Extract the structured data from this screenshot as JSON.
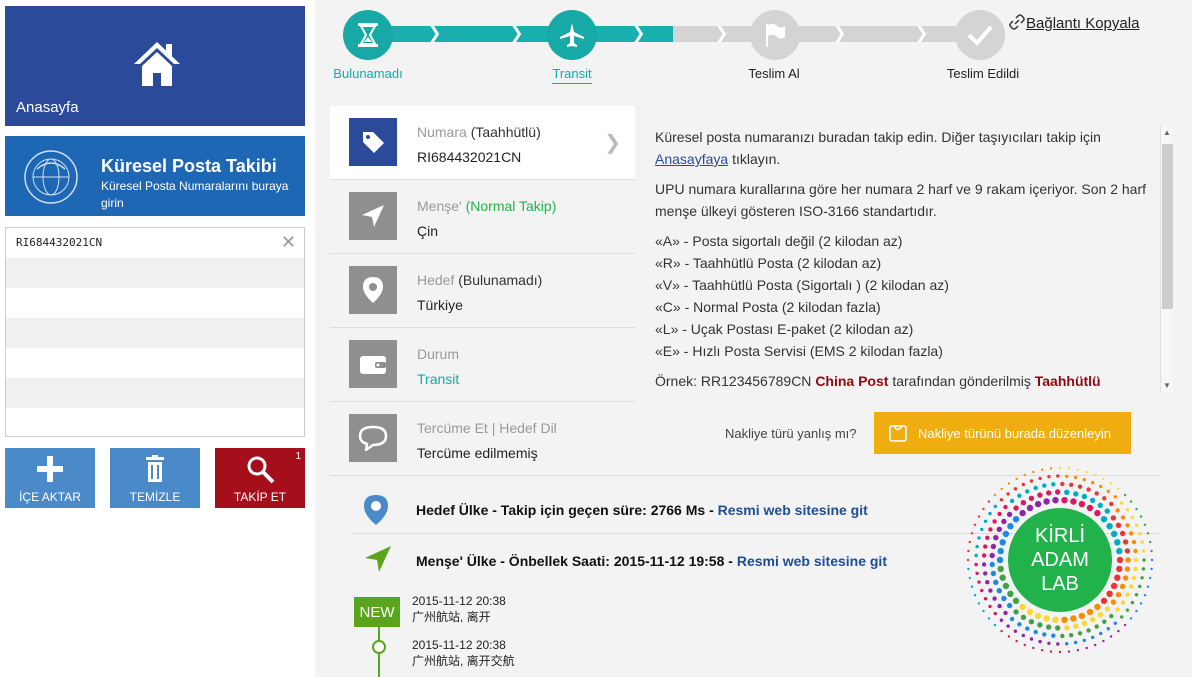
{
  "sidebar": {
    "home_label": "Anasayfa",
    "tracker_title": "Küresel Posta Takibi",
    "tracker_subtitle": "Küresel Posta Numaralarını buraya girin",
    "tracking_numbers": [
      "RI684432021CN"
    ],
    "buttons": {
      "import": "İÇE AKTAR",
      "clear": "TEMİZLE",
      "track": "TAKİP ET",
      "track_badge": "1"
    }
  },
  "progress": {
    "steps": [
      {
        "label": "Bulunamadı",
        "state": "done",
        "icon": "hourglass-icon"
      },
      {
        "label": "Transit",
        "state": "active",
        "icon": "plane-icon"
      },
      {
        "label": "Teslim Al",
        "state": "pending",
        "icon": "flag-icon"
      },
      {
        "label": "Teslim Edildi",
        "state": "pending",
        "icon": "check-icon"
      }
    ]
  },
  "copy_link": "Bağlantı Kopyala",
  "info": {
    "number_label": "Numara",
    "number_type": "(Taahhütlü)",
    "number_value": "RI684432021CN",
    "origin_label": "Menşe'",
    "origin_type": "(Normal Takip)",
    "origin_value": "Çin",
    "dest_label": "Hedef",
    "dest_type": "(Bulunamadı)",
    "dest_value": "Türkiye",
    "status_label": "Durum",
    "status_value": "Transit",
    "translate_label": "Tercüme Et | Hedef Dil",
    "translate_value": "Tercüme edilmemiş"
  },
  "help": {
    "p1_a": "Küresel posta numaranızı buradan takip edin. Diğer taşıyıcıları takip için",
    "p1_link": "Anasayfaya",
    "p1_b": "tıklayın.",
    "p2": "UPU numara kurallarına göre her numara 2 harf ve 9 rakam içeriyor. Son 2 harf menşe ülkeyi gösteren ISO-3166 standartıdır.",
    "rules": [
      "«A» - Posta sigortalı değil (2 kilodan az)",
      "«R» - Taahhütlü Posta (2 kilodan az)",
      "«V» - Taahhütlü Posta (Sigortalı ) (2 kilodan az)",
      "«C» - Normal Posta (2 kilodan fazla)",
      "«L» - Uçak Postası E-paket (2 kilodan az)",
      "«E» - Hızlı Posta Servisi (EMS 2 kilodan fazla)"
    ],
    "example_a": "Örnek: RR123456789CN",
    "example_carrier": "China Post",
    "example_b": "tarafından gönderilmiş",
    "example_type": "Taahhütlü"
  },
  "wrong_question": "Nakliye türü yanlış mı?",
  "edit_button": "Nakliye türünü burada düzenleyin",
  "dest_country": {
    "text": "Hedef Ülke - Takip için geçen süre: 2766 Ms -",
    "link": "Resmi web sitesine git"
  },
  "origin_country": {
    "text": "Menşe' Ülke - Önbellek Saati: 2015-11-12 19:58 -",
    "link": "Resmi web sitesine git"
  },
  "timeline": {
    "new_badge": "NEW",
    "events": [
      {
        "time": "2015-11-12 20:38",
        "desc": "广州航站, 离开"
      },
      {
        "time": "2015-11-12 20:38",
        "desc": "广州航站, 离开交航"
      }
    ]
  },
  "brand": {
    "line1": "KİRLİ",
    "line2": "ADAM",
    "line3": "LAB"
  },
  "colors": {
    "teal": "#16a9a6",
    "navy": "#2b4b9a",
    "red": "#a50e1b",
    "orange": "#f0ad10",
    "green": "#5ba41d"
  }
}
